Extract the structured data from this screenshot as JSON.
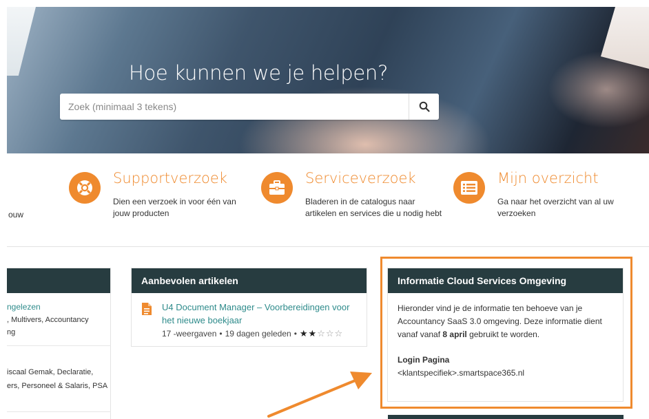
{
  "hero": {
    "title": "Hoe kunnen we je helpen?",
    "search_placeholder": "Zoek (minimaal 3 tekens)",
    "search_icon": "search-icon"
  },
  "tiles": [
    {
      "title": "Supportverzoek",
      "description": "Dien een verzoek in voor één van jouw producten",
      "icon": "lifebuoy-icon"
    },
    {
      "title": "Serviceverzoek",
      "description": "Bladeren in de catalogus naar artikelen en services die u nodig hebt",
      "icon": "briefcase-icon"
    },
    {
      "title": "Mijn overzicht",
      "description": "Ga naar het overzicht van al uw verzoeken",
      "icon": "list-icon"
    }
  ],
  "left_tile_fragment": "ouw",
  "left_panel": {
    "item1_link": "ngelezen",
    "item1_line2": ", Multivers, Accountancy",
    "item1_line3": "ng",
    "item2_line1": "iscaal Gemak, Declaratie,",
    "item2_line2": "ers, Personeel & Salaris, PSA"
  },
  "recommended": {
    "header": "Aanbevolen artikelen",
    "article_title": "U4 Document Manager – Voorbereidingen voor het nieuwe boekjaar",
    "views": "17 -weergaven",
    "age": "19 dagen geleden",
    "separator": "•",
    "rating": 2,
    "rating_max": 5
  },
  "info": {
    "header": "Informatie Cloud Services Omgeving",
    "text_before": "Hieronder vind je de informatie ten behoeve van je Accountancy SaaS 3.0 omgeving. Deze informatie dient vanaf vanaf ",
    "text_bold": "8 april",
    "text_after": " gebruikt te worden.",
    "login_label": "Login Pagina",
    "login_url": "<klantspecifiek>.smartspace365.nl"
  },
  "colors": {
    "accent": "#ef8a2e",
    "panel_header": "#273c40",
    "link": "#2e8b8b"
  }
}
